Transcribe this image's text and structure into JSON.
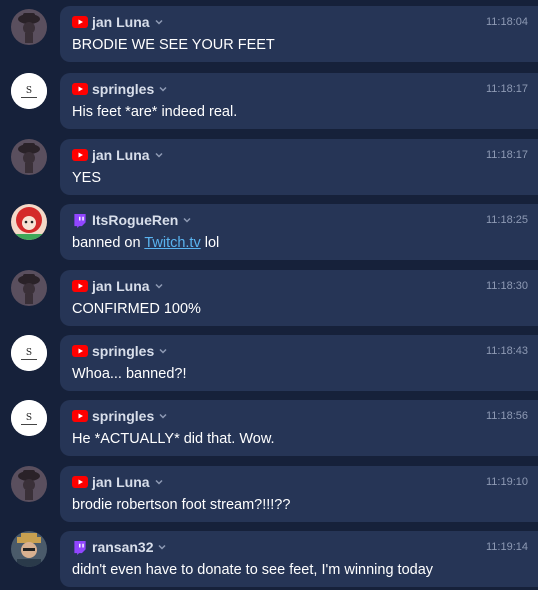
{
  "messages": [
    {
      "user": "jan Luna",
      "platform": "youtube",
      "avatar": "hooded-figure-avatar",
      "time": "11:18:04",
      "text": "BRODIE WE SEE YOUR FEET"
    },
    {
      "user": "springles",
      "platform": "youtube",
      "avatar": "s-logo-avatar",
      "time": "11:18:17",
      "text": "His feet *are* indeed real."
    },
    {
      "user": "jan Luna",
      "platform": "youtube",
      "avatar": "hooded-figure-avatar",
      "time": "11:18:17",
      "text": "YES"
    },
    {
      "user": "ItsRogueRen",
      "platform": "twitch",
      "avatar": "red-hair-avatar",
      "time": "11:18:25",
      "text_before": "banned on ",
      "link": "Twitch.tv",
      "text_after": " lol"
    },
    {
      "user": "jan Luna",
      "platform": "youtube",
      "avatar": "hooded-figure-avatar",
      "time": "11:18:30",
      "text": "CONFIRMED 100%"
    },
    {
      "user": "springles",
      "platform": "youtube",
      "avatar": "s-logo-avatar",
      "time": "11:18:43",
      "text": "Whoa... banned?!"
    },
    {
      "user": "springles",
      "platform": "youtube",
      "avatar": "s-logo-avatar",
      "time": "11:18:56",
      "text": "He *ACTUALLY* did that. Wow."
    },
    {
      "user": "jan Luna",
      "platform": "youtube",
      "avatar": "hooded-figure-avatar",
      "time": "11:19:10",
      "text": "brodie robertson foot stream?!!!??"
    },
    {
      "user": "ransan32",
      "platform": "twitch",
      "avatar": "hat-man-avatar",
      "time": "11:19:14",
      "text": "didn't even have to donate to see feet, I'm winning today"
    }
  ],
  "colors": {
    "background": "#16213a",
    "bubble": "#263556",
    "youtube": "#ff0000",
    "twitch": "#9146ff",
    "link": "#5ab4f0"
  }
}
